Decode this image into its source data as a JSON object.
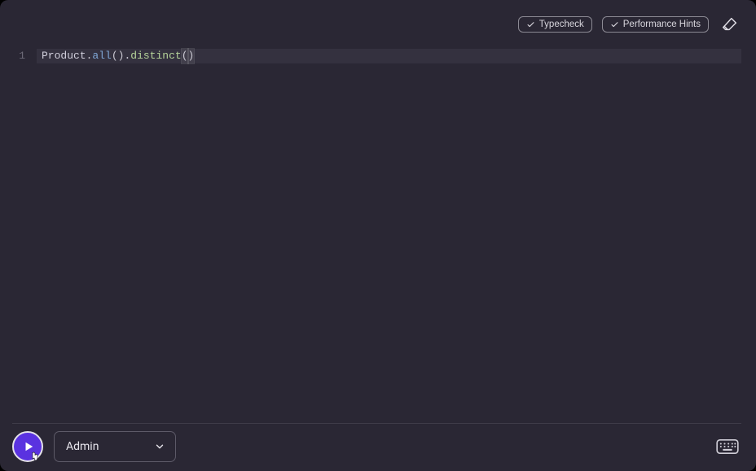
{
  "toolbar": {
    "typecheck_label": "Typecheck",
    "perf_label": "Performance Hints"
  },
  "editor": {
    "line_number": "1",
    "tokens": {
      "cls": "Product",
      "dot1": ".",
      "m1": "all",
      "p1a": "(",
      "p1b": ")",
      "dot2": ".",
      "m2": "distinct",
      "p2a": "(",
      "p2b": ")"
    }
  },
  "bottom": {
    "role": "Admin"
  }
}
